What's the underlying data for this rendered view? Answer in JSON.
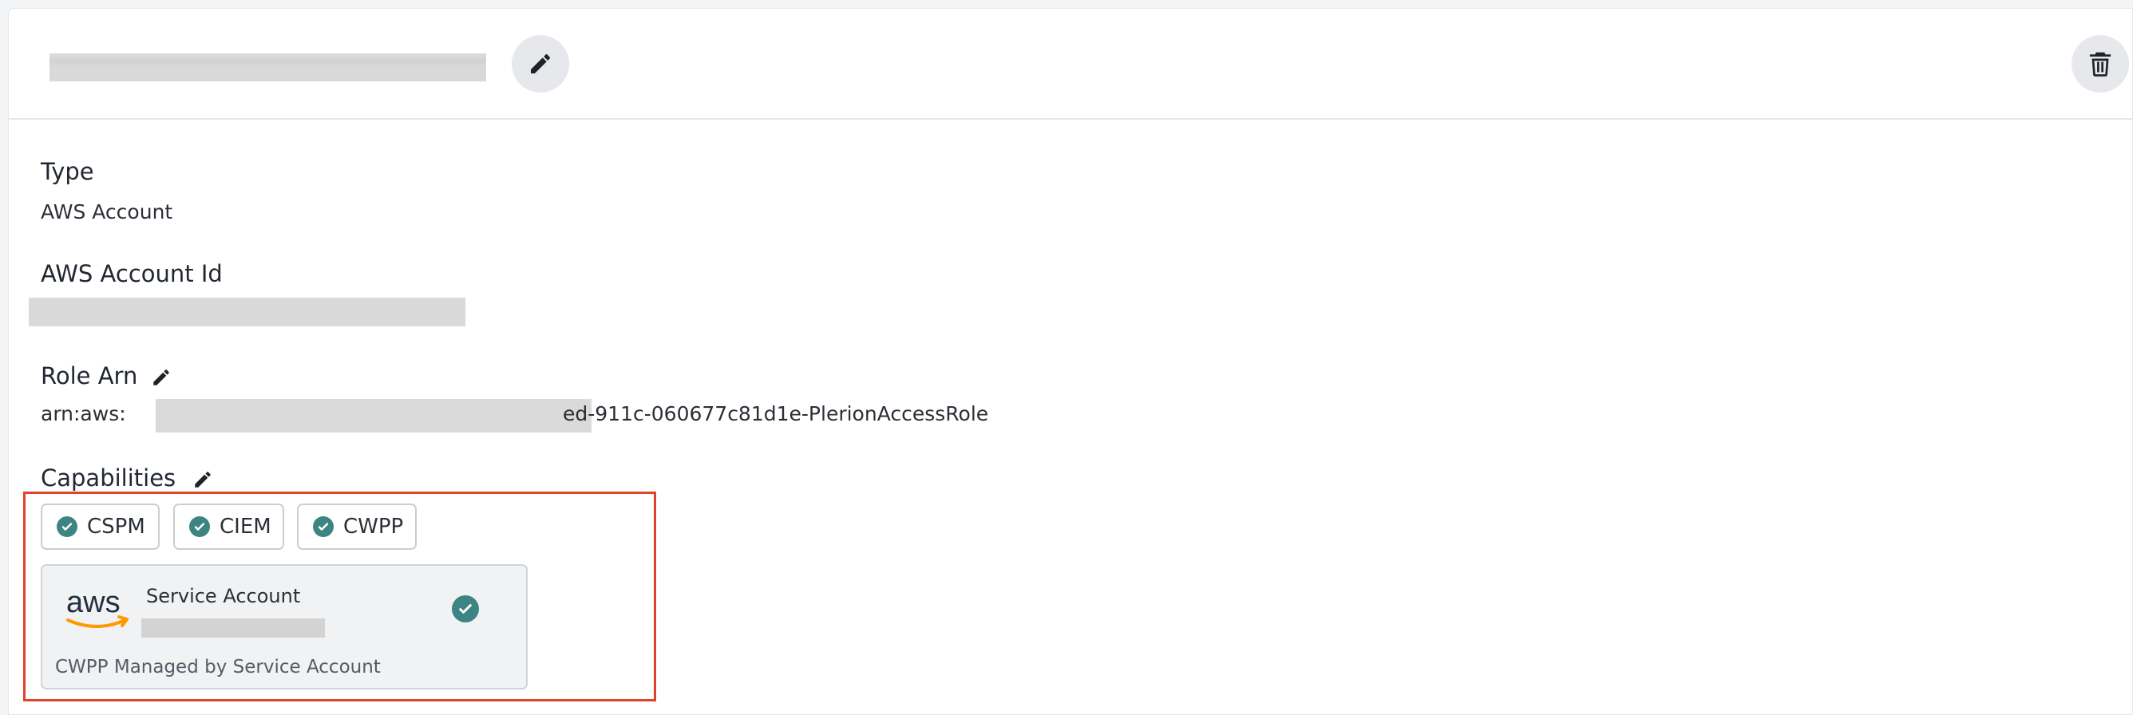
{
  "header": {
    "edit_icon": "pencil-icon",
    "delete_icon": "trash-icon"
  },
  "fields": {
    "type_label": "Type",
    "type_value": "AWS Account",
    "account_id_label": "AWS Account Id",
    "role_arn_label": "Role Arn",
    "role_arn_prefix": "arn:aws:",
    "role_arn_suffix": "ed-911c-060677c81d1e-PlerionAccessRole",
    "capabilities_label": "Capabilities"
  },
  "capabilities": [
    {
      "label": "CSPM"
    },
    {
      "label": "CIEM"
    },
    {
      "label": "CWPP"
    }
  ],
  "service_account": {
    "logo_text": "aws",
    "title": "Service Account",
    "footer": "CWPP Managed by Service Account"
  },
  "colors": {
    "accent_check": "#3d8582",
    "highlight": "#e0432b",
    "aws_orange": "#ff9900"
  }
}
